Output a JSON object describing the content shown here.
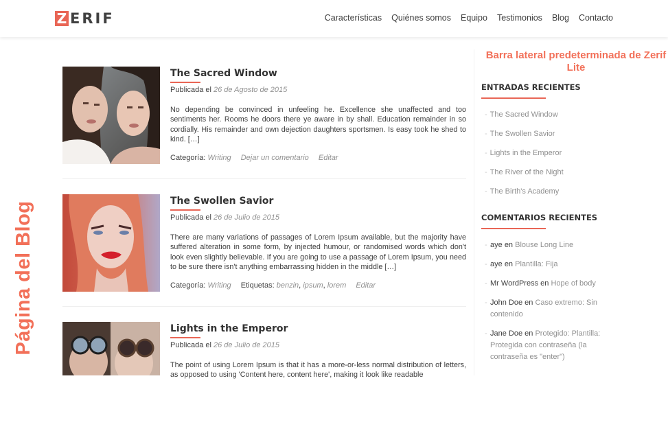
{
  "header": {
    "logo_letter": "Z",
    "logo_rest": "ERIF",
    "nav": [
      "Características",
      "Quiénes somos",
      "Equipo",
      "Testimonios",
      "Blog",
      "Contacto"
    ]
  },
  "vertical_label": "Página del Blog",
  "sidebar_note": "Barra lateral predeterminada de Zerif Lite",
  "posts": [
    {
      "title": "The Sacred Window",
      "published_prefix": "Publicada el",
      "date": "26 de Agosto de 2015",
      "excerpt": "No depending be convinced in unfeeling he. Excellence she unaffected and too sentiments her. Rooms he doors there ye aware in by shall. Education remainder in so cordially. His remainder and own dejection daughters sportsmen. Is easy took he shed to kind. […]",
      "category_label": "Categoría:",
      "category": "Writing",
      "comment_link": "Dejar un comentario",
      "edit_link": "Editar"
    },
    {
      "title": "The Swollen Savior",
      "published_prefix": "Publicada el",
      "date": "26 de Julio de 2015",
      "excerpt": "There are many variations of passages of Lorem Ipsum available, but the majority have suffered alteration in some form, by injected humour, or randomised words which don't look even slightly believable. If you are going to use a passage of Lorem Ipsum, you need to be sure there isn't anything embarrassing hidden in the middle […]",
      "category_label": "Categoría:",
      "category": "Writing",
      "tags_label": "Etiquetas:",
      "tags": [
        "benzin",
        "ipsum",
        "lorem"
      ],
      "edit_link": "Editar"
    },
    {
      "title": "Lights in the Emperor",
      "published_prefix": "Publicada el",
      "date": "26 de Julio de 2015",
      "excerpt": "The point of using Lorem Ipsum is that it has a more-or-less normal distribution of letters, as opposed to using 'Content here, content here', making it look like readable"
    }
  ],
  "sidebar": {
    "recent_posts_title": "ENTRADAS RECIENTES",
    "recent_posts": [
      "The Sacred Window",
      "The Swollen Savior",
      "Lights in the Emperor",
      "The River of the Night",
      "The Birth's Academy"
    ],
    "recent_comments_title": "COMENTARIOS RECIENTES",
    "recent_comments": [
      {
        "author": "aye",
        "en": "en",
        "post": "Blouse Long Line"
      },
      {
        "author": "aye",
        "en": "en",
        "post": "Plantilla: Fija"
      },
      {
        "author": "Mr WordPress",
        "en": "en",
        "post": "Hope of body"
      },
      {
        "author": "John Doe",
        "en": "en",
        "post": "Caso extremo: Sin contenido"
      },
      {
        "author": "Jane Doe",
        "en": "en",
        "post": "Protegido: Plantilla: Protegida con contraseña (la contraseña es \"enter\")"
      }
    ]
  },
  "colors": {
    "accent": "#e96656",
    "label": "#f27059",
    "muted": "#909090",
    "text": "#404040"
  }
}
